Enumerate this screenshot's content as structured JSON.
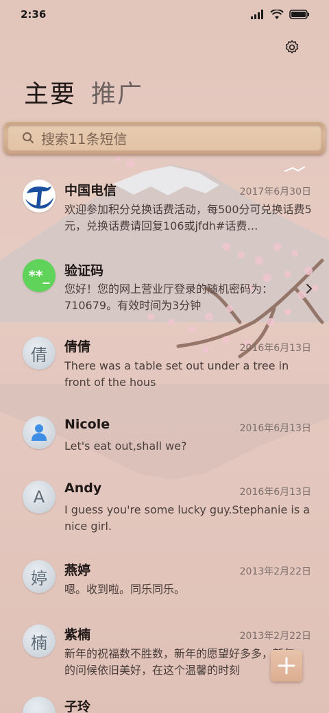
{
  "status_bar": {
    "time": "2:36"
  },
  "tabs": [
    {
      "label": "主要",
      "active": true
    },
    {
      "label": "推广",
      "active": false
    }
  ],
  "search": {
    "placeholder": "搜索11条短信"
  },
  "conversations": [
    {
      "name": "中国电信",
      "date": "2017年6月30日",
      "preview": "欢迎参加积分兑换话费活动，每500分可兑换话费5元，兑换话费请回复106或jfdh#话费…",
      "avatar_icon": "china-telecom-logo"
    },
    {
      "name": "验证码",
      "date": "",
      "preview": "您好！您的网上营业厅登录的随机密码为：710679。有效时间为3分钟",
      "avatar_icon": "verification-code-icon",
      "avatar_text": "**_"
    },
    {
      "name": "倩倩",
      "date": "2016年6月13日",
      "preview": "There was a table set out under a tree in front of the hous",
      "avatar_text": "倩"
    },
    {
      "name": "Nicole",
      "date": "2016年6月13日",
      "preview": "Let's eat out,shall we?",
      "avatar_icon": "person-icon"
    },
    {
      "name": "Andy",
      "date": "2016年6月13日",
      "preview": "I guess you're some lucky guy.Stephanie is a nice girl.",
      "avatar_text": "A"
    },
    {
      "name": "燕婷",
      "date": "2013年2月22日",
      "preview": "嗯。收到啦。同乐同乐。",
      "avatar_text": "婷"
    },
    {
      "name": "紫楠",
      "date": "2013年2月22日",
      "preview": "新年的祝福数不胜数，新年的愿望好多多，新年的问候依旧美好，在这个温馨的时刻",
      "avatar_text": "楠"
    },
    {
      "name": "子玲",
      "date": "",
      "preview": "",
      "avatar_text": ""
    }
  ],
  "colors": {
    "background": "#e6c9bf",
    "verification_avatar": "#5fd35a",
    "telecom_blue": "#1a4fa0"
  }
}
